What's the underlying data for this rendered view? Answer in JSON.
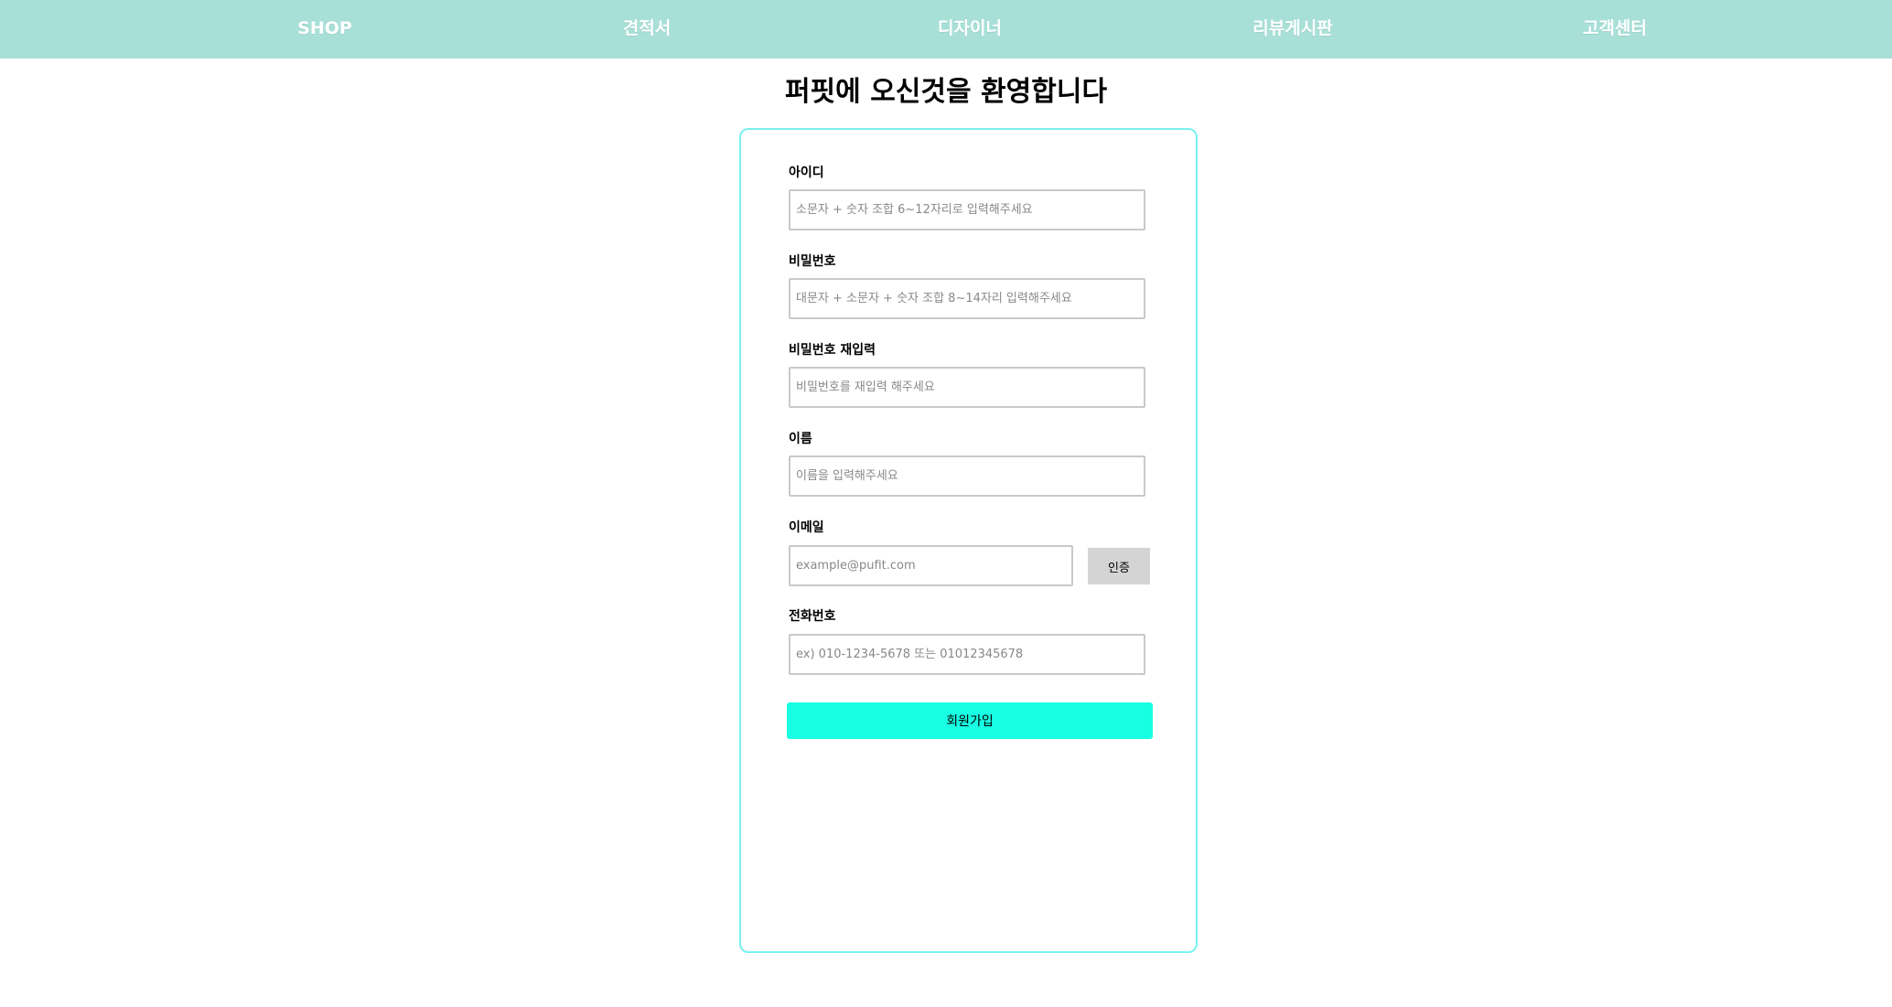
{
  "nav": {
    "items": [
      {
        "label": "SHOP"
      },
      {
        "label": "견적서"
      },
      {
        "label": "디자이너"
      },
      {
        "label": "리뷰게시판"
      },
      {
        "label": "고객센터"
      }
    ]
  },
  "page_title": "퍼핏에 오신것을 환영합니다",
  "form": {
    "fields": {
      "id": {
        "label": "아이디",
        "placeholder": "소문자 + 숫자 조합 6~12자리로 입력해주세요",
        "value": ""
      },
      "password": {
        "label": "비밀번호",
        "placeholder": "대문자 + 소문자 + 숫자 조합 8~14자리 입력해주세요",
        "value": ""
      },
      "password_confirm": {
        "label": "비밀번호 재입력",
        "placeholder": "비밀번호를 재입력 해주세요",
        "value": ""
      },
      "name": {
        "label": "이름",
        "placeholder": "이름을 입력해주세요",
        "value": ""
      },
      "email": {
        "label": "이메일",
        "placeholder": "example@pufit.com",
        "value": ""
      },
      "phone": {
        "label": "전화번호",
        "placeholder": "ex) 010-1234-5678 또는 01012345678",
        "value": ""
      }
    },
    "verify_button": "인증",
    "submit_button": "회원가입"
  },
  "colors": {
    "nav_background": "#a8e0d8",
    "card_border": "#7af0ef",
    "submit_background": "#18ffe3",
    "verify_background": "#d4d4d4"
  }
}
